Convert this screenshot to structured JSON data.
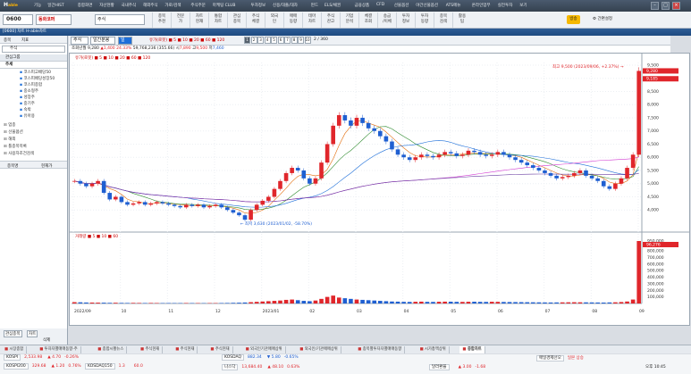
{
  "app": {
    "logo_main": "H",
    "logo_sub": "able"
  },
  "menu": [
    "기능",
    "일간HIST",
    "종합화면",
    "자산현황",
    "국내주식",
    "해외주식",
    "가로/검색",
    "주식주문",
    "마케팅 CLUB",
    "투자정보",
    "신용/대출/대차",
    "펀드",
    "ELS/채권",
    "금융상품",
    "CFD",
    "선물옵션",
    "야간선물옵션",
    "ATS메뉴",
    "온라인업무",
    "실전투자",
    "보기"
  ],
  "toolbar": {
    "code": "0600",
    "stock_name": "동화코퍼",
    "account": "주식",
    "buttons": [
      "종목\n추천",
      "전문\n가",
      "차트\n현재",
      "통합\n차트",
      "관심\n종목",
      "주식\n체결",
      "외국\n인",
      "매매\n동향",
      "테마\n차트",
      "주식\n잔고",
      "기업\n분석",
      "체결\n조회",
      "송금\n/이체",
      "투자\n정보",
      "투자\n동향",
      "종목\n검색",
      "활용\n팁"
    ],
    "realtime_badge": "방송",
    "setting_label": "간편설정"
  },
  "window_title": "[0600] 차트 H-able차트",
  "left": {
    "tabs": [
      "종목",
      "지표"
    ],
    "head1": "관심그룹",
    "head2": "추세",
    "items": [
      "코스피고배당50",
      "코스피배당성장50",
      "코스피종합",
      "중소형주",
      "성장주",
      "중기주",
      "숙박",
      "유아용"
    ],
    "sections": [
      "업종",
      "선물옵션",
      "해외",
      "틀종목목록",
      "사용자조건검색"
    ],
    "bottom_tabs": [
      "종목명",
      "현재가"
    ],
    "bottom_controls": [
      "관심종목",
      "차트",
      "삭제"
    ]
  },
  "chart_toolbar": {
    "interval": "일",
    "count": "120",
    "period_label": "일간분봉",
    "select": "주식",
    "btn_labels": [
      "1",
      "2",
      "3",
      "4",
      "5",
      "6",
      "7",
      "8",
      "9",
      "10"
    ],
    "display": "2 / 360"
  },
  "info": {
    "date": "조회년월 9,280",
    "close": "▲1,400",
    "pct": "24.33%",
    "vol": "59,768,236",
    "amt": "(355.66)",
    "label_open": "시",
    "open": "7,890",
    "label_high": "고",
    "high": "9,500",
    "label_low": "저",
    "low": "7,460"
  },
  "price_legend": "유가(로봇)  ■ 5 ■ 10 ■ 20 ■ 60 ■ 120",
  "vol_legend": "거래량  ■ 5 ■ 10 ■ 60",
  "annotations": {
    "high": "최고 9,500 (2023/09/06, +2.37%) →",
    "low": "← 최저 3,630 (2023/01/02, -58.70%)"
  },
  "price_axis": [
    "9,500",
    "9,000",
    "8,500",
    "8,000",
    "7,500",
    "7,000",
    "6,500",
    "6,000",
    "5,500",
    "5,000",
    "4,500",
    "4,000"
  ],
  "vol_axis": [
    "950,000",
    "900,000",
    "800,000",
    "700,000",
    "600,000",
    "500,000",
    "400,000",
    "300,000",
    "200,000",
    "100,000"
  ],
  "date_axis": [
    "2022/09",
    "10",
    "11",
    "12",
    "2023/01",
    "02",
    "03",
    "04",
    "05",
    "06",
    "07",
    "08",
    "09"
  ],
  "price_tags": {
    "last": "9,280",
    "prev": "9,185",
    "vol_last": "96,276"
  },
  "bottom_tabs": [
    "시장종합",
    "투자자별매매동향-주",
    "종합시황뉴스",
    "주식현재",
    "주식현재",
    "주식현재",
    "외국인기관매매상위",
    "외국인/기관매매상위",
    "종목별투자자별매매동향",
    "시가총액상위",
    "종합차트"
  ],
  "ticker": [
    {
      "name": "KOSPI",
      "val": "2,533.98",
      "chg": "▲ 4.70",
      "pct": "-0.26%"
    },
    {
      "name": "KOSPI200",
      "val": "329.68",
      "chg": "▲ 1.20",
      "pct": "0.76%"
    },
    {
      "name": "KOSDAQ",
      "val": "882.34",
      "chg": "▼ 5.80",
      "pct": "-0.65%"
    },
    {
      "name": "매일경제선오",
      "val": "일본 상승",
      "chg": "",
      "pct": ""
    },
    {
      "name": "KOSDAQ150",
      "val": "1.3",
      "chg": "",
      "pct": "60.0"
    },
    {
      "name": "나스닥",
      "val": "13,684.40",
      "chg": "▲ 48.10",
      "pct": "0.63%"
    },
    {
      "name": "달러환율",
      "val": "",
      "chg": "▲ 3.00",
      "pct": "-1.68"
    }
  ],
  "clock": "오후 10:45",
  "colors": {
    "up": "#e0262b",
    "down": "#1f5fd1",
    "ma5": "#e36c0a",
    "ma10": "#2c8a2c",
    "ma20": "#1e6fd9",
    "ma60": "#d23bd2",
    "ma120": "#6a3ea1"
  },
  "chart_data": {
    "type": "candlestick",
    "x": [
      "2022/09",
      "10",
      "11",
      "12",
      "2023/01",
      "02",
      "03",
      "04",
      "05",
      "06",
      "07",
      "08",
      "09"
    ],
    "ylim": [
      3500,
      9600
    ],
    "close": [
      5100,
      5000,
      4900,
      5000,
      5100,
      4650,
      4400,
      4500,
      4300,
      4200,
      4250,
      4300,
      4200,
      4250,
      4300,
      4250,
      4200,
      4150,
      4100,
      4200,
      4150,
      4200,
      4100,
      4150,
      4200,
      4100,
      4000,
      3900,
      3800,
      3630,
      4000,
      4200,
      4350,
      4500,
      4800,
      5100,
      5400,
      5600,
      5500,
      5200,
      5000,
      5200,
      5800,
      6500,
      7200,
      7600,
      7400,
      7200,
      7500,
      7300,
      7100,
      7000,
      6800,
      6600,
      6300,
      6100,
      6000,
      5900,
      6000,
      6100,
      6050,
      6000,
      6100,
      6200,
      6150,
      6050,
      6100,
      6250,
      6200,
      6100,
      6050,
      6100,
      6200,
      6100,
      6000,
      5900,
      5800,
      5700,
      5600,
      5500,
      5400,
      5300,
      5200,
      5250,
      5300,
      5400,
      5500,
      5300,
      5200,
      5100,
      4900,
      4800,
      5000,
      5200,
      5600,
      6100,
      9280
    ],
    "volume": [
      20,
      18,
      15,
      14,
      13,
      12,
      10,
      11,
      9,
      8,
      9,
      8,
      7,
      8,
      7,
      6,
      7,
      6,
      6,
      7,
      6,
      6,
      5,
      6,
      6,
      7,
      8,
      10,
      12,
      15,
      20,
      25,
      30,
      35,
      40,
      45,
      55,
      60,
      50,
      40,
      35,
      45,
      70,
      100,
      120,
      90,
      80,
      70,
      60,
      55,
      50,
      45,
      40,
      35,
      30,
      28,
      25,
      24,
      26,
      28,
      25,
      24,
      26,
      28,
      27,
      25,
      24,
      26,
      27,
      25,
      24,
      26,
      25,
      23,
      22,
      21,
      20,
      19,
      18,
      17,
      16,
      15,
      16,
      17,
      18,
      19,
      18,
      17,
      16,
      15,
      14,
      16,
      18,
      22,
      30,
      60,
      950
    ]
  }
}
